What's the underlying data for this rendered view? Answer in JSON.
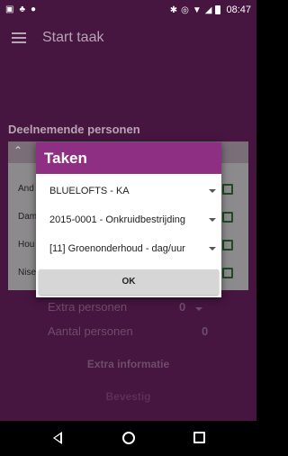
{
  "status_bar": {
    "time": "08:47"
  },
  "toolbar": {
    "title": "Start taak"
  },
  "section": {
    "title": "Deelnemende personen"
  },
  "persons": [
    {
      "name": "And"
    },
    {
      "name": "Dam"
    },
    {
      "name": "Hou"
    },
    {
      "name": "Nise"
    }
  ],
  "extra": {
    "extra_personen_label": "Extra personen",
    "extra_personen_value": "0",
    "aantal_personen_label": "Aantal personen",
    "aantal_personen_value": "0",
    "info_label": "Extra informatie",
    "confirm_label": "Bevestig"
  },
  "dialog": {
    "title": "Taken",
    "spinner1": "BLUELOFTS - KA",
    "spinner2": "2015-0001 - Onkruidbestrijding",
    "spinner3": "[11] Groenonderhoud - dag/uur",
    "ok_label": "OK"
  },
  "colors": {
    "accent": "#8f2f84",
    "background": "#461540"
  }
}
